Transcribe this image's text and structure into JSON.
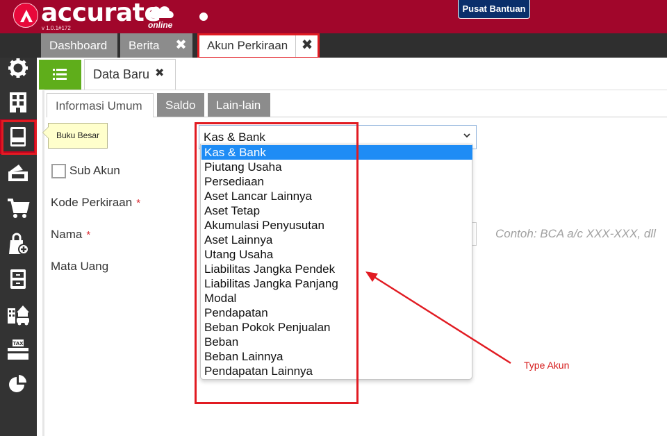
{
  "header": {
    "brand": "accurate",
    "brand_sub": "online",
    "version": "v 1.0.1#172",
    "help_label": "Pusat Bantuan",
    "colors": {
      "bar": "#a1062b",
      "help_bg": "#0a2f6b"
    }
  },
  "tabs": [
    {
      "label": "Dashboard",
      "closable": false
    },
    {
      "label": "Berita",
      "closable": true
    },
    {
      "label": "Akun Perkiraan",
      "closable": true,
      "active": true
    }
  ],
  "tab_close_glyph": "✖",
  "sidebar": {
    "items": [
      {
        "icon": "gear-icon"
      },
      {
        "icon": "building-icon"
      },
      {
        "icon": "ledger-book-icon",
        "active": true
      },
      {
        "icon": "cash-hand-icon"
      },
      {
        "icon": "cart-icon"
      },
      {
        "icon": "shopping-bag-add-icon"
      },
      {
        "icon": "cabinet-icon"
      },
      {
        "icon": "building-car-icon"
      },
      {
        "icon": "tax-icon"
      },
      {
        "icon": "pie-chart-icon"
      }
    ],
    "tooltip": "Buku Besar"
  },
  "document": {
    "tab_label": "Data Baru",
    "close_glyph": "✖",
    "list_button_icon": "list-icon",
    "inner_tabs": [
      "Informasi Umum",
      "Saldo",
      "Lain-lain"
    ]
  },
  "form": {
    "type_select_value": "Kas & Bank",
    "sub_akun_label": "Sub Akun",
    "kode_label": "Kode Perkiraan",
    "nama_label": "Nama",
    "mata_uang_label": "Mata Uang",
    "required_mark": "*",
    "nama_hint": "Contoh: BCA a/c XXX-XXX, dll"
  },
  "dropdown_options": [
    "Kas & Bank",
    "Piutang Usaha",
    "Persediaan",
    "Aset Lancar Lainnya",
    "Aset Tetap",
    "Akumulasi Penyusutan",
    "Aset Lainnya",
    "Utang Usaha",
    "Liabilitas Jangka Pendek",
    "Liabilitas Jangka Panjang",
    "Modal",
    "Pendapatan",
    "Beban Pokok Penjualan",
    "Beban",
    "Beban Lainnya",
    "Pendapatan Lainnya"
  ],
  "dropdown_selected": "Kas & Bank",
  "annotation": {
    "label": "Type Akun",
    "color": "#e11b22"
  }
}
